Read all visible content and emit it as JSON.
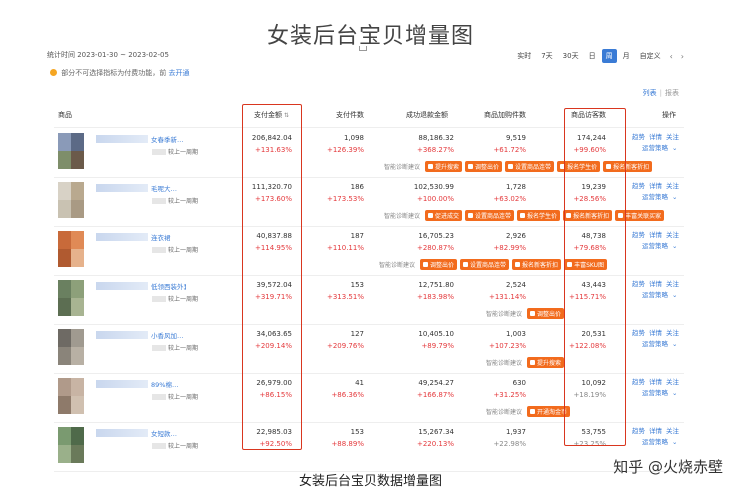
{
  "page_title": "女装后台宝贝增量图",
  "caption": "女装后台宝贝数据增量图",
  "watermark": "知乎 @火烧赤壁",
  "toolbar": {
    "period_text": "统计时间 2023-01-30 ~ 2023-02-05",
    "period_buttons": [
      "实时",
      "7天",
      "30天",
      "日",
      "周",
      "月",
      "自定义"
    ],
    "active_button": "周"
  },
  "notice": {
    "text": "部分不可选择指标为付费功能，前",
    "link": "去开通"
  },
  "view_switch": {
    "list": "列表",
    "chart": "报表"
  },
  "columns": {
    "product": "商品",
    "pay_amount": "支付金额",
    "pay_count": "支付件数",
    "refund_amount": "成功退款金额",
    "cart_count": "商品加购件数",
    "visitors": "商品访客数",
    "ops": "操作"
  },
  "ops_labels": {
    "trend": "趋势",
    "detail": "详情",
    "follow": "关注",
    "strategy": "运营策略"
  },
  "strategy_label": "智能诊断建议",
  "colors": {
    "accent": "#3a7bd5",
    "increase": "#e4393c",
    "tag": "#f26b1d",
    "highlight": "#d9361f"
  },
  "rows": [
    {
      "name": "女春季新…",
      "compare": "较上一周期",
      "pay_amount": "206,842.04",
      "pay_amount_pct": "+131.63%",
      "pay_count": "1,098",
      "pay_count_pct": "+126.39%",
      "refund_amount": "88,186.32",
      "refund_amount_pct": "+368.27%",
      "cart_count": "9,519",
      "cart_count_pct": "+61.72%",
      "visitors": "174,244",
      "visitors_pct": "+99.60%",
      "tags": [
        "提升搜索",
        "调整出价",
        "设置商品连带",
        "报名学生价",
        "报名新客折扣"
      ]
    },
    {
      "name": "毛呢大…",
      "compare": "较上一周期",
      "pay_amount": "111,320.70",
      "pay_amount_pct": "+173.60%",
      "pay_count": "186",
      "pay_count_pct": "+173.53%",
      "refund_amount": "102,530.99",
      "refund_amount_pct": "+100.00%",
      "cart_count": "1,728",
      "cart_count_pct": "+63.02%",
      "visitors": "19,239",
      "visitors_pct": "+28.56%",
      "tags": [
        "促进成交",
        "设置商品连带",
        "报名学生价",
        "报名新客折扣",
        "丰富关联买家"
      ]
    },
    {
      "name": "连衣裙",
      "compare": "较上一周期",
      "pay_amount": "40,837.88",
      "pay_amount_pct": "+114.95%",
      "pay_count": "187",
      "pay_count_pct": "+110.11%",
      "refund_amount": "16,705.23",
      "refund_amount_pct": "+280.87%",
      "cart_count": "2,926",
      "cart_count_pct": "+82.99%",
      "visitors": "48,738",
      "visitors_pct": "+79.68%",
      "tags": [
        "调整出价",
        "设置商品连带",
        "报名新客折扣",
        "丰富SKU图"
      ]
    },
    {
      "name": "低领西装外套…",
      "compare": "较上一周期",
      "pay_amount": "39,572.04",
      "pay_amount_pct": "+319.71%",
      "pay_count": "153",
      "pay_count_pct": "+313.51%",
      "refund_amount": "12,751.80",
      "refund_amount_pct": "+183.98%",
      "cart_count": "2,524",
      "cart_count_pct": "+131.14%",
      "visitors": "43,443",
      "visitors_pct": "+115.71%",
      "tags": [
        "调整出价"
      ]
    },
    {
      "name": "小香风加…",
      "compare": "较上一周期",
      "pay_amount": "34,063.65",
      "pay_amount_pct": "+209.14%",
      "pay_count": "127",
      "pay_count_pct": "+209.76%",
      "refund_amount": "10,405.10",
      "refund_amount_pct": "+89.79%",
      "cart_count": "1,003",
      "cart_count_pct": "+107.23%",
      "visitors": "20,531",
      "visitors_pct": "+122.08%",
      "tags": [
        "提升搜索"
      ]
    },
    {
      "name": "89%棉…",
      "compare": "较上一周期",
      "pay_amount": "26,979.00",
      "pay_amount_pct": "+86.15%",
      "pay_count": "41",
      "pay_count_pct": "+86.36%",
      "refund_amount": "49,254.27",
      "refund_amount_pct": "+166.87%",
      "cart_count": "630",
      "cart_count_pct": "+31.25%",
      "visitors": "10,092",
      "visitors_pct": "+18.19%",
      "tags": [
        "开通淘金币"
      ]
    },
    {
      "name": "女短款…",
      "compare": "较上一周期",
      "pay_amount": "22,985.03",
      "pay_amount_pct": "+92.50%",
      "pay_count": "153",
      "pay_count_pct": "+88.89%",
      "refund_amount": "15,267.34",
      "refund_amount_pct": "+220.13%",
      "cart_count": "1,937",
      "cart_count_pct": "+22.98%",
      "visitors": "53,755",
      "visitors_pct": "+23.25%",
      "tags": []
    }
  ]
}
